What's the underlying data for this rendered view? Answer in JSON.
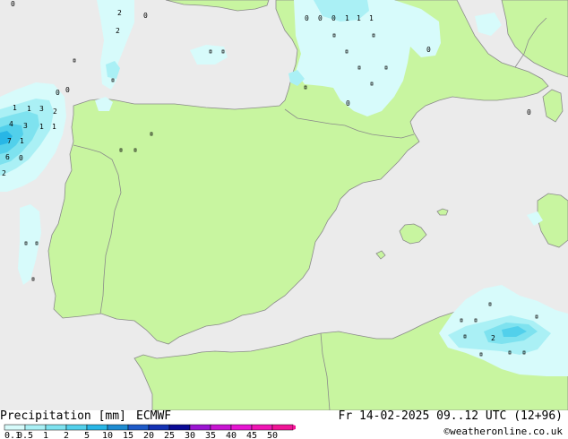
{
  "map": {
    "colors": {
      "sea": "#ebebeb",
      "land": "#c8f5a0",
      "border": "#808080",
      "coast": "#8a8a8a"
    },
    "point_values": [
      "0",
      "2",
      "2",
      "0",
      "0",
      "0",
      "0",
      "1",
      "1",
      "1",
      "0",
      "0",
      "0",
      "2",
      "0",
      "1",
      "1",
      "3",
      "2",
      "4",
      "3",
      "1",
      "1",
      "7",
      "1",
      "6",
      "0",
      "2",
      "0"
    ]
  },
  "footer": {
    "title": "Precipitation [mm]",
    "model": "ECMWF",
    "valid_time": "Fr 14-02-2025 09..12 UTC (12+96)",
    "credit": "©weatheronline.co.uk",
    "legend": {
      "labels": [
        "0.1",
        "0.5",
        "1",
        "2",
        "5",
        "10",
        "15",
        "20",
        "25",
        "30",
        "35",
        "40",
        "45",
        "50"
      ],
      "colors": [
        "#d7fbfb",
        "#aaf0f5",
        "#7ee2ef",
        "#52d0eb",
        "#28b6e6",
        "#1e8cd2",
        "#1e5ac8",
        "#1432b4",
        "#0a0a96",
        "#9b14d2",
        "#c814d2",
        "#e614d2",
        "#f014b4",
        "#f01496"
      ]
    }
  }
}
